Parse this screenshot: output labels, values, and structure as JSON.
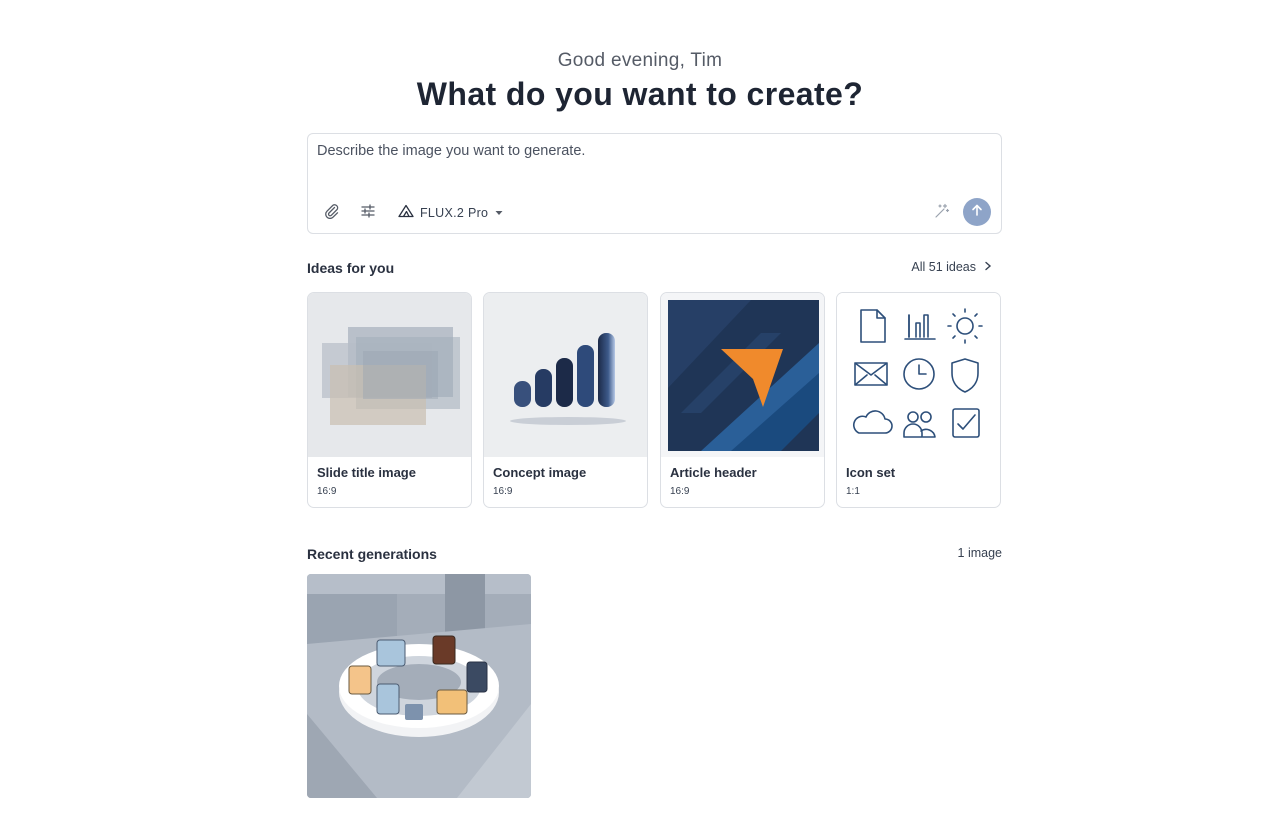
{
  "header": {
    "greeting": "Good evening, Tim",
    "headline": "What do you want to create?"
  },
  "prompt": {
    "placeholder": "Describe the image you want to generate.",
    "value": "",
    "model": "FLUX.2 Pro",
    "icons": [
      "paperclip-icon",
      "sliders-icon",
      "model-triangle-icon",
      "chevron-down-icon",
      "magic-wand-icon",
      "arrow-up-icon"
    ]
  },
  "ideas": {
    "title": "Ideas for you",
    "all_link": "All 51 ideas",
    "cards": [
      {
        "title": "Slide title image",
        "ratio": "16:9"
      },
      {
        "title": "Concept image",
        "ratio": "16:9"
      },
      {
        "title": "Article header",
        "ratio": "16:9"
      },
      {
        "title": "Icon set",
        "ratio": "1:1"
      }
    ]
  },
  "recent": {
    "title": "Recent generations",
    "count": "1 image"
  },
  "colors": {
    "accent": "#8ea4c8",
    "heading": "#1e2533",
    "border": "#dcdfe4",
    "orange": "#f08a2c",
    "navy": "#1f3556"
  }
}
